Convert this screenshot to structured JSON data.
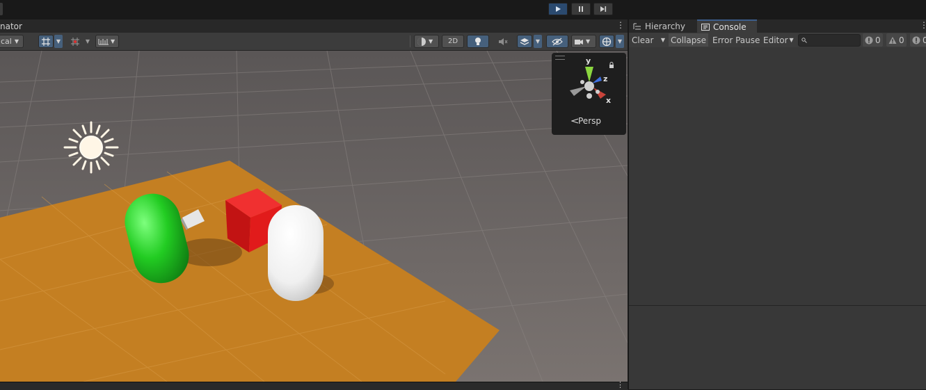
{
  "scene": {
    "tab_label": "nator",
    "draw_mode_label": "cal",
    "two_d_label": "2D",
    "gizmo": {
      "y_label": "y",
      "z_label": "z",
      "x_label": "x",
      "persp_label": "Persp"
    }
  },
  "hierarchy": {
    "tab_label": "Hierarchy"
  },
  "console": {
    "tab_label": "Console",
    "clear_label": "Clear",
    "collapse_label": "Collapse",
    "error_pause_label": "Error Pause",
    "editor_label": "Editor",
    "search_placeholder": "",
    "info_count": "0",
    "warning_count": "0",
    "error_count": "0"
  },
  "colors": {
    "accent": "#2b4a6f",
    "plane": "#c47f22",
    "cube": "#e11b1b",
    "capsule_green": "#22cc22",
    "capsule_white": "#f0f0f0",
    "sky": "#6e6866"
  },
  "icons": [
    "play-icon",
    "pause-icon",
    "step-icon",
    "grid-snap-icon",
    "light-icon",
    "audio-mute-icon",
    "fx-icon",
    "visibility-icon",
    "camera-icon",
    "gizmo-icon",
    "more-menu-icon",
    "search-icon",
    "info-icon",
    "warning-icon",
    "error-icon",
    "sun-icon",
    "lock-icon"
  ]
}
